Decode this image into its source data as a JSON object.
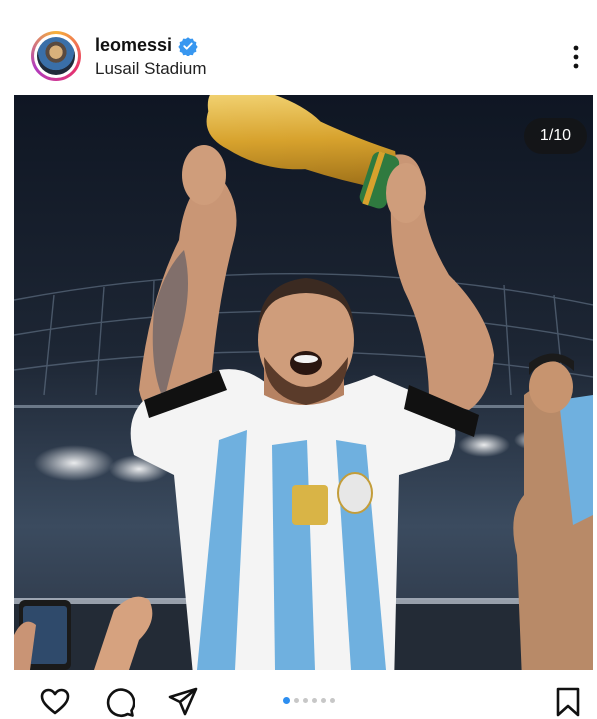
{
  "post": {
    "username": "leomessi",
    "location": "Lusail Stadium",
    "counter": "1/10",
    "carousel": {
      "current": 1,
      "total": 10,
      "dots_visible": 6
    }
  },
  "icons": {
    "verified": "verified-badge-icon",
    "more": "more-options-icon",
    "like": "heart-icon",
    "comment": "comment-icon",
    "share": "send-icon",
    "save": "bookmark-icon"
  },
  "colors": {
    "verified_blue": "#3897f0",
    "carousel_active": "#2d8ef0",
    "carousel_inactive": "#c7c7c7",
    "text": "#111111"
  }
}
